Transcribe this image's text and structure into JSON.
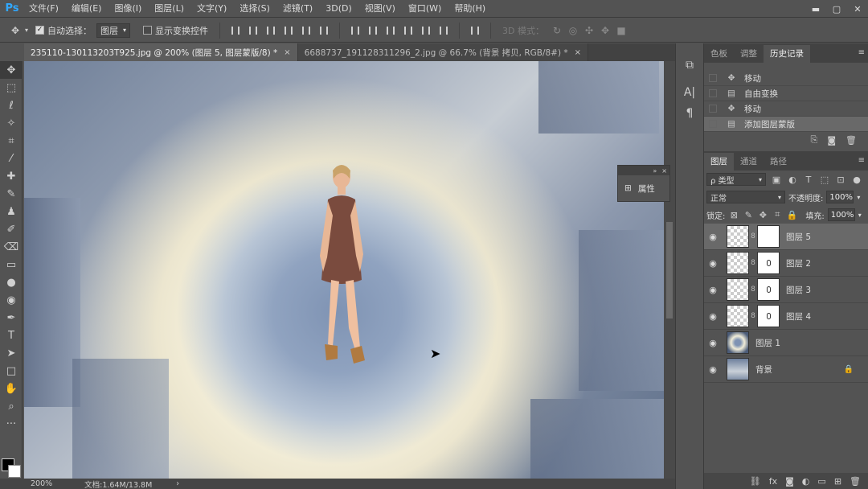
{
  "app": {
    "logo": "Ps"
  },
  "menu": [
    "文件(F)",
    "编辑(E)",
    "图像(I)",
    "图层(L)",
    "文字(Y)",
    "选择(S)",
    "滤镜(T)",
    "3D(D)",
    "视图(V)",
    "窗口(W)",
    "帮助(H)"
  ],
  "window_controls": {
    "minimize": "▬",
    "maximize": "▢",
    "close": "✕"
  },
  "options": {
    "auto_select_label": "自动选择：",
    "auto_select_value": "图层",
    "show_transform_label": "显示变换控件",
    "mode3d_label": "3D 模式："
  },
  "tabs": [
    {
      "label": "235110-130113203T925.jpg @ 200% (图层 5, 图层蒙版/8) *",
      "close": "×"
    },
    {
      "label": "6688737_191128311296_2.jpg @ 66.7% (背景 拷贝, RGB/8#) *",
      "close": "×"
    }
  ],
  "status": {
    "zoom": "200%",
    "doc": "文档:1.64M/13.8M",
    "arrow": "›"
  },
  "properties_panel": {
    "title": "属性",
    "collapse": "»",
    "close": "×"
  },
  "history_panel": {
    "tabs": [
      "色板",
      "调整",
      "历史记录"
    ],
    "items": [
      {
        "icon": "move",
        "label": "移动"
      },
      {
        "icon": "doc",
        "label": "自由变换"
      },
      {
        "icon": "move",
        "label": "移动"
      },
      {
        "icon": "doc",
        "label": "添加图层蒙版"
      }
    ]
  },
  "layers_panel": {
    "tabs": [
      "图层",
      "通道",
      "路径"
    ],
    "filter_label": "ρ 类型",
    "blend_mode": "正常",
    "opacity_label": "不透明度:",
    "opacity_value": "100%",
    "lock_label": "锁定:",
    "fill_label": "填充:",
    "fill_value": "100%",
    "layers": [
      {
        "name": "图层 5",
        "selected": true,
        "type": "masked"
      },
      {
        "name": "图层 2",
        "selected": false,
        "type": "masked"
      },
      {
        "name": "图层 3",
        "selected": false,
        "type": "masked"
      },
      {
        "name": "图层 4",
        "selected": false,
        "type": "masked"
      },
      {
        "name": "图层 1",
        "selected": false,
        "type": "image"
      },
      {
        "name": "背景",
        "selected": false,
        "type": "background"
      }
    ]
  },
  "colors": {
    "accent": "#31a8ff",
    "panel": "#535353",
    "dark": "#424242",
    "selected": "#696969"
  }
}
